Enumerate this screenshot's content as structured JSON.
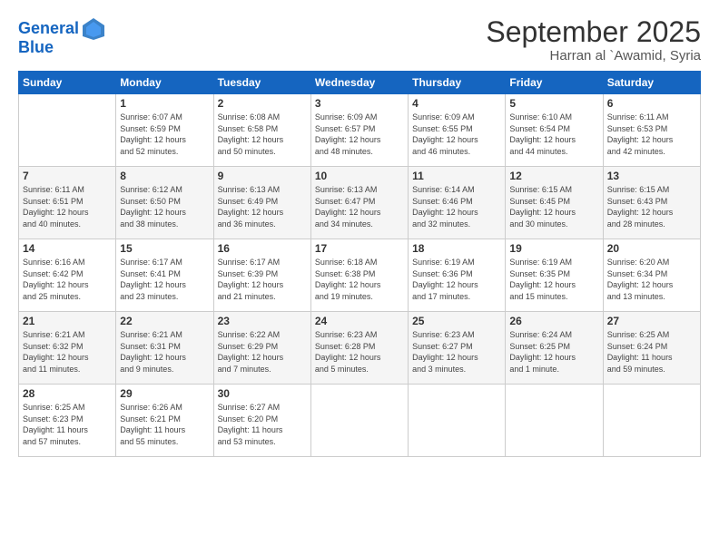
{
  "logo": {
    "line1": "General",
    "line2": "Blue"
  },
  "title": "September 2025",
  "subtitle": "Harran al `Awamid, Syria",
  "days_header": [
    "Sunday",
    "Monday",
    "Tuesday",
    "Wednesday",
    "Thursday",
    "Friday",
    "Saturday"
  ],
  "weeks": [
    [
      {
        "num": "",
        "info": ""
      },
      {
        "num": "1",
        "info": "Sunrise: 6:07 AM\nSunset: 6:59 PM\nDaylight: 12 hours\nand 52 minutes."
      },
      {
        "num": "2",
        "info": "Sunrise: 6:08 AM\nSunset: 6:58 PM\nDaylight: 12 hours\nand 50 minutes."
      },
      {
        "num": "3",
        "info": "Sunrise: 6:09 AM\nSunset: 6:57 PM\nDaylight: 12 hours\nand 48 minutes."
      },
      {
        "num": "4",
        "info": "Sunrise: 6:09 AM\nSunset: 6:55 PM\nDaylight: 12 hours\nand 46 minutes."
      },
      {
        "num": "5",
        "info": "Sunrise: 6:10 AM\nSunset: 6:54 PM\nDaylight: 12 hours\nand 44 minutes."
      },
      {
        "num": "6",
        "info": "Sunrise: 6:11 AM\nSunset: 6:53 PM\nDaylight: 12 hours\nand 42 minutes."
      }
    ],
    [
      {
        "num": "7",
        "info": "Sunrise: 6:11 AM\nSunset: 6:51 PM\nDaylight: 12 hours\nand 40 minutes."
      },
      {
        "num": "8",
        "info": "Sunrise: 6:12 AM\nSunset: 6:50 PM\nDaylight: 12 hours\nand 38 minutes."
      },
      {
        "num": "9",
        "info": "Sunrise: 6:13 AM\nSunset: 6:49 PM\nDaylight: 12 hours\nand 36 minutes."
      },
      {
        "num": "10",
        "info": "Sunrise: 6:13 AM\nSunset: 6:47 PM\nDaylight: 12 hours\nand 34 minutes."
      },
      {
        "num": "11",
        "info": "Sunrise: 6:14 AM\nSunset: 6:46 PM\nDaylight: 12 hours\nand 32 minutes."
      },
      {
        "num": "12",
        "info": "Sunrise: 6:15 AM\nSunset: 6:45 PM\nDaylight: 12 hours\nand 30 minutes."
      },
      {
        "num": "13",
        "info": "Sunrise: 6:15 AM\nSunset: 6:43 PM\nDaylight: 12 hours\nand 28 minutes."
      }
    ],
    [
      {
        "num": "14",
        "info": "Sunrise: 6:16 AM\nSunset: 6:42 PM\nDaylight: 12 hours\nand 25 minutes."
      },
      {
        "num": "15",
        "info": "Sunrise: 6:17 AM\nSunset: 6:41 PM\nDaylight: 12 hours\nand 23 minutes."
      },
      {
        "num": "16",
        "info": "Sunrise: 6:17 AM\nSunset: 6:39 PM\nDaylight: 12 hours\nand 21 minutes."
      },
      {
        "num": "17",
        "info": "Sunrise: 6:18 AM\nSunset: 6:38 PM\nDaylight: 12 hours\nand 19 minutes."
      },
      {
        "num": "18",
        "info": "Sunrise: 6:19 AM\nSunset: 6:36 PM\nDaylight: 12 hours\nand 17 minutes."
      },
      {
        "num": "19",
        "info": "Sunrise: 6:19 AM\nSunset: 6:35 PM\nDaylight: 12 hours\nand 15 minutes."
      },
      {
        "num": "20",
        "info": "Sunrise: 6:20 AM\nSunset: 6:34 PM\nDaylight: 12 hours\nand 13 minutes."
      }
    ],
    [
      {
        "num": "21",
        "info": "Sunrise: 6:21 AM\nSunset: 6:32 PM\nDaylight: 12 hours\nand 11 minutes."
      },
      {
        "num": "22",
        "info": "Sunrise: 6:21 AM\nSunset: 6:31 PM\nDaylight: 12 hours\nand 9 minutes."
      },
      {
        "num": "23",
        "info": "Sunrise: 6:22 AM\nSunset: 6:29 PM\nDaylight: 12 hours\nand 7 minutes."
      },
      {
        "num": "24",
        "info": "Sunrise: 6:23 AM\nSunset: 6:28 PM\nDaylight: 12 hours\nand 5 minutes."
      },
      {
        "num": "25",
        "info": "Sunrise: 6:23 AM\nSunset: 6:27 PM\nDaylight: 12 hours\nand 3 minutes."
      },
      {
        "num": "26",
        "info": "Sunrise: 6:24 AM\nSunset: 6:25 PM\nDaylight: 12 hours\nand 1 minute."
      },
      {
        "num": "27",
        "info": "Sunrise: 6:25 AM\nSunset: 6:24 PM\nDaylight: 11 hours\nand 59 minutes."
      }
    ],
    [
      {
        "num": "28",
        "info": "Sunrise: 6:25 AM\nSunset: 6:23 PM\nDaylight: 11 hours\nand 57 minutes."
      },
      {
        "num": "29",
        "info": "Sunrise: 6:26 AM\nSunset: 6:21 PM\nDaylight: 11 hours\nand 55 minutes."
      },
      {
        "num": "30",
        "info": "Sunrise: 6:27 AM\nSunset: 6:20 PM\nDaylight: 11 hours\nand 53 minutes."
      },
      {
        "num": "",
        "info": ""
      },
      {
        "num": "",
        "info": ""
      },
      {
        "num": "",
        "info": ""
      },
      {
        "num": "",
        "info": ""
      }
    ]
  ]
}
